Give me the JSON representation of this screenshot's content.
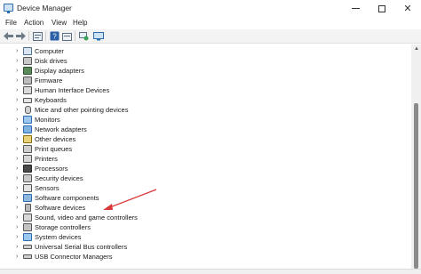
{
  "window": {
    "title": "Device Manager",
    "minimize_glyph": "—",
    "close_glyph": "✕"
  },
  "menu": [
    "File",
    "Action",
    "View",
    "Help"
  ],
  "toolbar": {
    "buttons": [
      "back-icon",
      "forward-icon",
      "properties-icon",
      "help-icon",
      "update-driver-icon",
      "scan-hardware-icon"
    ]
  },
  "tree": {
    "expand_glyph": "›",
    "items": [
      {
        "label": "Computer",
        "icon": "computer-icon"
      },
      {
        "label": "Disk drives",
        "icon": "disk-drive-icon"
      },
      {
        "label": "Display adapters",
        "icon": "display-adapter-icon"
      },
      {
        "label": "Firmware",
        "icon": "firmware-icon"
      },
      {
        "label": "Human Interface Devices",
        "icon": "hid-icon"
      },
      {
        "label": "Keyboards",
        "icon": "keyboard-icon"
      },
      {
        "label": "Mice and other pointing devices",
        "icon": "mouse-icon"
      },
      {
        "label": "Monitors",
        "icon": "monitor-icon"
      },
      {
        "label": "Network adapters",
        "icon": "network-adapter-icon"
      },
      {
        "label": "Other devices",
        "icon": "other-devices-icon"
      },
      {
        "label": "Print queues",
        "icon": "print-queue-icon"
      },
      {
        "label": "Printers",
        "icon": "printer-icon"
      },
      {
        "label": "Processors",
        "icon": "processor-icon"
      },
      {
        "label": "Security devices",
        "icon": "security-device-icon"
      },
      {
        "label": "Sensors",
        "icon": "sensor-icon"
      },
      {
        "label": "Software components",
        "icon": "software-component-icon"
      },
      {
        "label": "Software devices",
        "icon": "software-device-icon"
      },
      {
        "label": "Sound, video and game controllers",
        "icon": "sound-icon"
      },
      {
        "label": "Storage controllers",
        "icon": "storage-controller-icon"
      },
      {
        "label": "System devices",
        "icon": "system-device-icon"
      },
      {
        "label": "Universal Serial Bus controllers",
        "icon": "usb-icon"
      },
      {
        "label": "USB Connector Managers",
        "icon": "usb-connector-icon"
      }
    ]
  },
  "annotation": {
    "arrow_color": "#d93a3a",
    "points_to": "Software devices"
  },
  "colors": {
    "accent": "#2b6cb0",
    "toolbar_bg": "#f3f3f3"
  }
}
